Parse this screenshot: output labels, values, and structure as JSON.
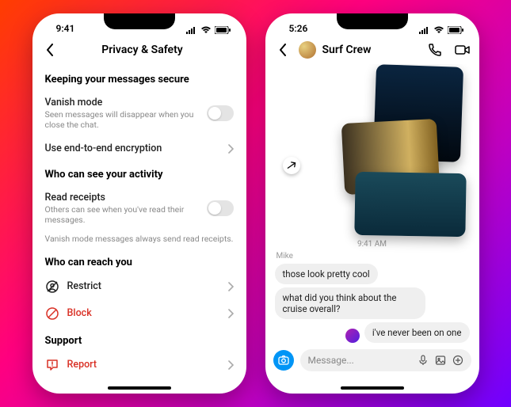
{
  "left": {
    "status_time": "9:41",
    "header_title": "Privacy & Safety",
    "section_secure": "Keeping your messages secure",
    "vanish": {
      "label": "Vanish mode",
      "sub": "Seen messages will disappear when you close the chat."
    },
    "e2e_label": "Use end-to-end encryption",
    "section_activity": "Who can see your activity",
    "read_receipts": {
      "label": "Read receipts",
      "sub": "Others can see when you've read their messages."
    },
    "vanish_note": "Vanish mode messages always send read receipts.",
    "section_reach": "Who can reach you",
    "restrict_label": "Restrict",
    "block_label": "Block",
    "section_support": "Support",
    "report_label": "Report"
  },
  "right": {
    "status_time": "5:26",
    "chat_title": "Surf Crew",
    "timestamp": "9:41 AM",
    "sender": "Mike",
    "msg1": "those look pretty cool",
    "msg2": "what did you think about the cruise overall?",
    "msg3": "i've never been on one",
    "placeholder": "Message..."
  }
}
